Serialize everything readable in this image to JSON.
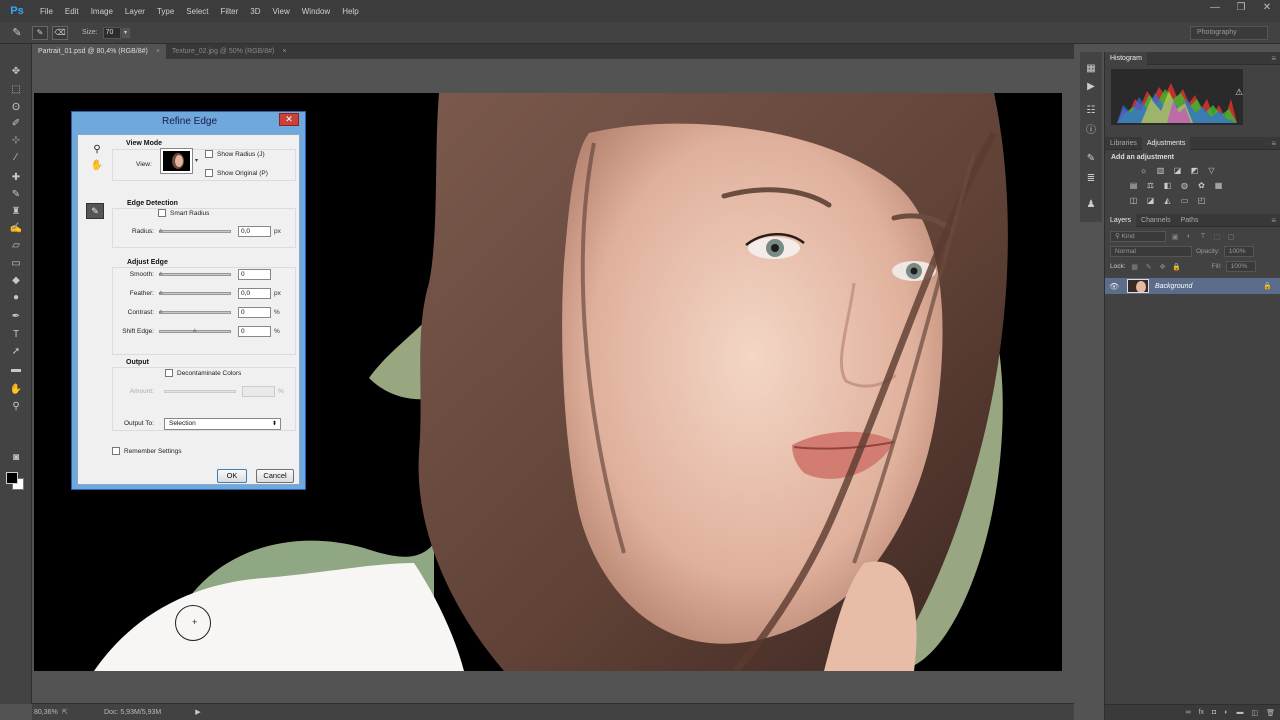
{
  "app": {
    "logo": "Ps"
  },
  "menu": [
    "File",
    "Edit",
    "Image",
    "Layer",
    "Type",
    "Select",
    "Filter",
    "3D",
    "View",
    "Window",
    "Help"
  ],
  "window_controls": {
    "minimize": "—",
    "restore": "❐",
    "close": "✕"
  },
  "options_bar": {
    "size_label": "Size:",
    "size_value": "70",
    "workspace": "Photography"
  },
  "tabs": [
    {
      "label": "Partrait_01.psd @ 80,4% (RGB/8#)",
      "close": "×"
    },
    {
      "label": "Texture_02.jpg @ 50% (RGB/8#)",
      "close": "×"
    }
  ],
  "status": {
    "zoom": "80,36%",
    "doc": "Doc: 5,93M/5,93M",
    "arrow": "▶"
  },
  "panels": {
    "histogram": {
      "tab": "Histogram",
      "menu": "≡"
    },
    "adjustments": {
      "tabs": [
        "Libraries",
        "Adjustments"
      ],
      "title": "Add an adjustment",
      "menu": "≡"
    },
    "layers": {
      "tabs": [
        "Layers",
        "Channels",
        "Paths"
      ],
      "menu": "≡",
      "kind": "Kind",
      "blend": "Normal",
      "opacity_label": "Opacity:",
      "opacity_value": "100%",
      "lock_label": "Lock:",
      "fill_label": "Fill:",
      "fill_value": "100%",
      "layer_name": "Background"
    }
  },
  "dialog": {
    "title": "Refine Edge",
    "close": "✕",
    "view_mode": {
      "title": "View Mode",
      "view_label": "View:",
      "show_radius": "Show Radius (J)",
      "show_original": "Show Original (P)"
    },
    "edge_detection": {
      "title": "Edge Detection",
      "smart_radius": "Smart Radius",
      "radius_label": "Radius:",
      "radius_value": "0,0",
      "radius_unit": "px"
    },
    "adjust_edge": {
      "title": "Adjust Edge",
      "smooth_label": "Smooth:",
      "smooth_value": "0",
      "feather_label": "Feather:",
      "feather_value": "0,0",
      "feather_unit": "px",
      "contrast_label": "Contrast:",
      "contrast_value": "0",
      "contrast_unit": "%",
      "shift_label": "Shift Edge:",
      "shift_value": "0",
      "shift_unit": "%"
    },
    "output": {
      "title": "Output",
      "decontaminate": "Decontaminate Colors",
      "amount_label": "Amount:",
      "amount_unit": "%",
      "output_to_label": "Output To:",
      "output_to_value": "Selection"
    },
    "remember": "Remember Settings",
    "ok": "OK",
    "cancel": "Cancel"
  }
}
